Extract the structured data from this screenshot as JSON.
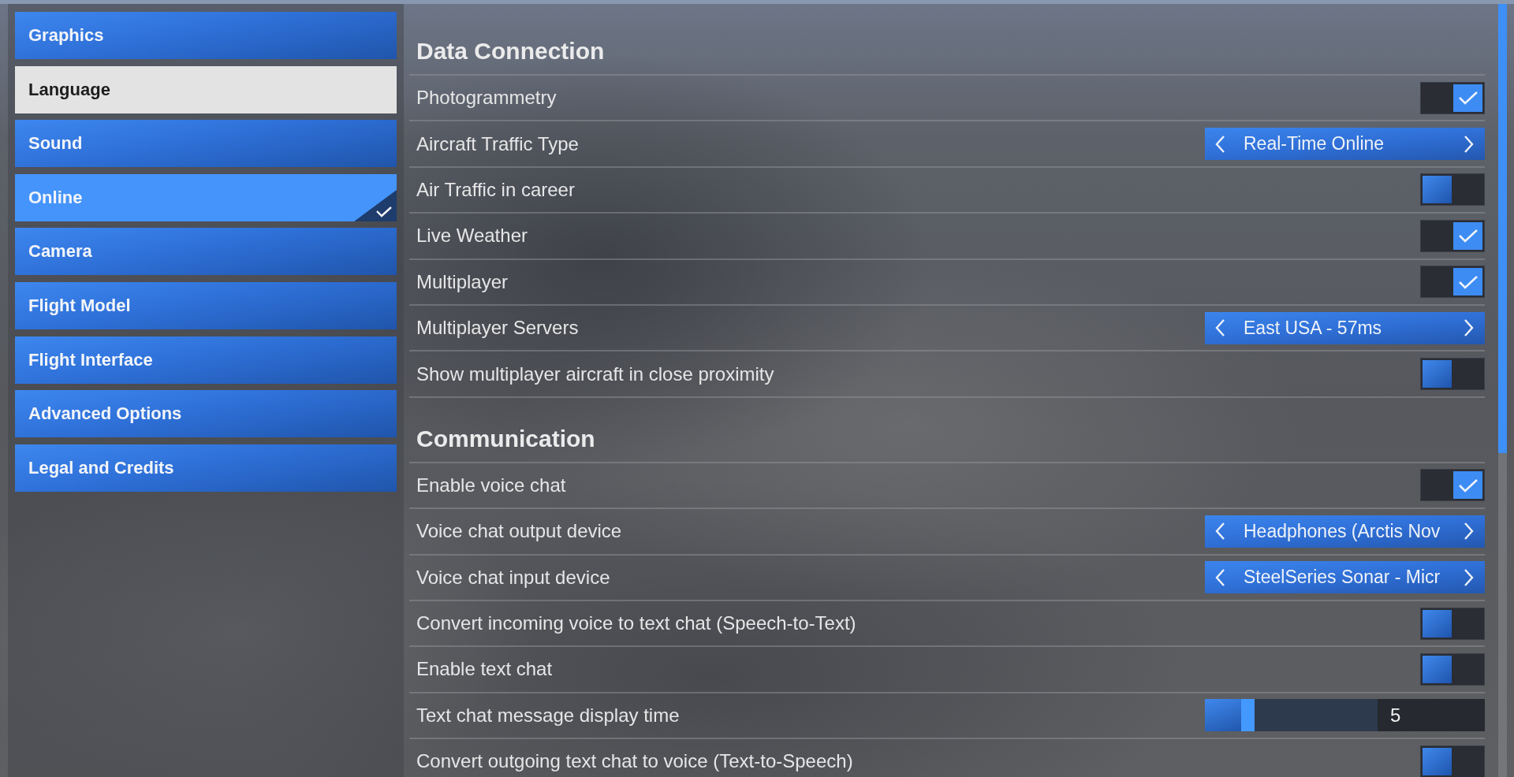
{
  "sidebar": {
    "items": [
      {
        "label": "Graphics",
        "selected": false,
        "highlighted": false
      },
      {
        "label": "Language",
        "selected": false,
        "highlighted": true
      },
      {
        "label": "Sound",
        "selected": false,
        "highlighted": false
      },
      {
        "label": "Online",
        "selected": true,
        "highlighted": false
      },
      {
        "label": "Camera",
        "selected": false,
        "highlighted": false
      },
      {
        "label": "Flight Model",
        "selected": false,
        "highlighted": false
      },
      {
        "label": "Flight Interface",
        "selected": false,
        "highlighted": false
      },
      {
        "label": "Advanced Options",
        "selected": false,
        "highlighted": false
      },
      {
        "label": "Legal and Credits",
        "selected": false,
        "highlighted": false
      }
    ]
  },
  "sections": [
    {
      "title": "Data Connection",
      "settings": [
        {
          "kind": "toggle",
          "label": "Photogrammetry",
          "on": true
        },
        {
          "kind": "selector",
          "label": "Aircraft Traffic Type",
          "value": "Real-Time Online"
        },
        {
          "kind": "toggle",
          "label": "Air Traffic in career",
          "on": false
        },
        {
          "kind": "toggle",
          "label": "Live Weather",
          "on": true
        },
        {
          "kind": "toggle",
          "label": "Multiplayer",
          "on": true
        },
        {
          "kind": "selector",
          "label": "Multiplayer Servers",
          "value": "East USA - 57ms"
        },
        {
          "kind": "toggle",
          "label": "Show multiplayer aircraft in close proximity",
          "on": false
        }
      ]
    },
    {
      "title": "Communication",
      "settings": [
        {
          "kind": "toggle",
          "label": "Enable voice chat",
          "on": true
        },
        {
          "kind": "selector",
          "label": "Voice chat output device",
          "value": "Headphones (Arctis Nov"
        },
        {
          "kind": "selector",
          "label": "Voice chat input device",
          "value": "SteelSeries Sonar - Micr"
        },
        {
          "kind": "toggle",
          "label": "Convert incoming voice to text chat (Speech-to-Text)",
          "on": false
        },
        {
          "kind": "toggle",
          "label": "Enable text chat",
          "on": false
        },
        {
          "kind": "slider",
          "label": "Text chat message display time",
          "level": 0.25,
          "reading": "5"
        },
        {
          "kind": "toggle",
          "label": "Convert outgoing text chat to voice (Text-to-Speech)",
          "on": false
        }
      ]
    }
  ]
}
